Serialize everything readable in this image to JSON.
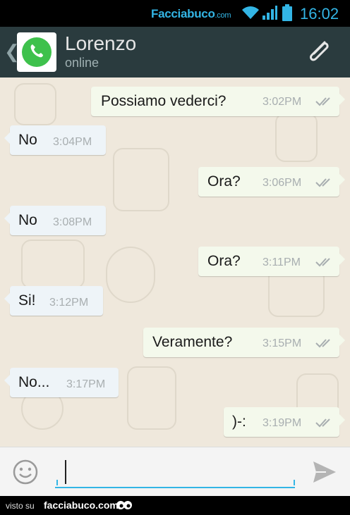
{
  "status_bar": {
    "brand": "Facciabuco",
    "brand_suffix": ".com",
    "time": "16:02",
    "icons": [
      "wifi-icon",
      "signal-icon",
      "battery-icon"
    ]
  },
  "header": {
    "contact_name": "Lorenzo",
    "contact_status": "online",
    "icons": [
      "back-chevron-icon",
      "whatsapp-avatar-icon",
      "paperclip-icon"
    ]
  },
  "messages": [
    {
      "direction": "out",
      "text": "Possiamo vederci?",
      "time": "3:02PM",
      "read": true
    },
    {
      "direction": "in",
      "text": "No",
      "time": "3:04PM"
    },
    {
      "direction": "out",
      "text": "Ora?",
      "time": "3:06PM",
      "read": true
    },
    {
      "direction": "in",
      "text": "No",
      "time": "3:08PM"
    },
    {
      "direction": "out",
      "text": "Ora?",
      "time": "3:11PM",
      "read": true
    },
    {
      "direction": "in",
      "text": "Si!",
      "time": "3:12PM"
    },
    {
      "direction": "out",
      "text": "Veramente?",
      "time": "3:15PM",
      "read": true
    },
    {
      "direction": "in",
      "text": "No...",
      "time": "3:17PM"
    },
    {
      "direction": "out",
      "text": ")-:",
      "time": "3:19PM",
      "read": true
    }
  ],
  "composer": {
    "value": "",
    "icons": [
      "emoji-icon",
      "send-icon"
    ]
  },
  "footer": {
    "visto": "visto su",
    "site": "facciabuco.com"
  },
  "colors": {
    "header_bg": "#2a3b3e",
    "chat_bg": "#efe8dc",
    "accent": "#33b5e5",
    "whatsapp_green": "#3ec14c",
    "tick_gray": "#a8aeb0"
  }
}
